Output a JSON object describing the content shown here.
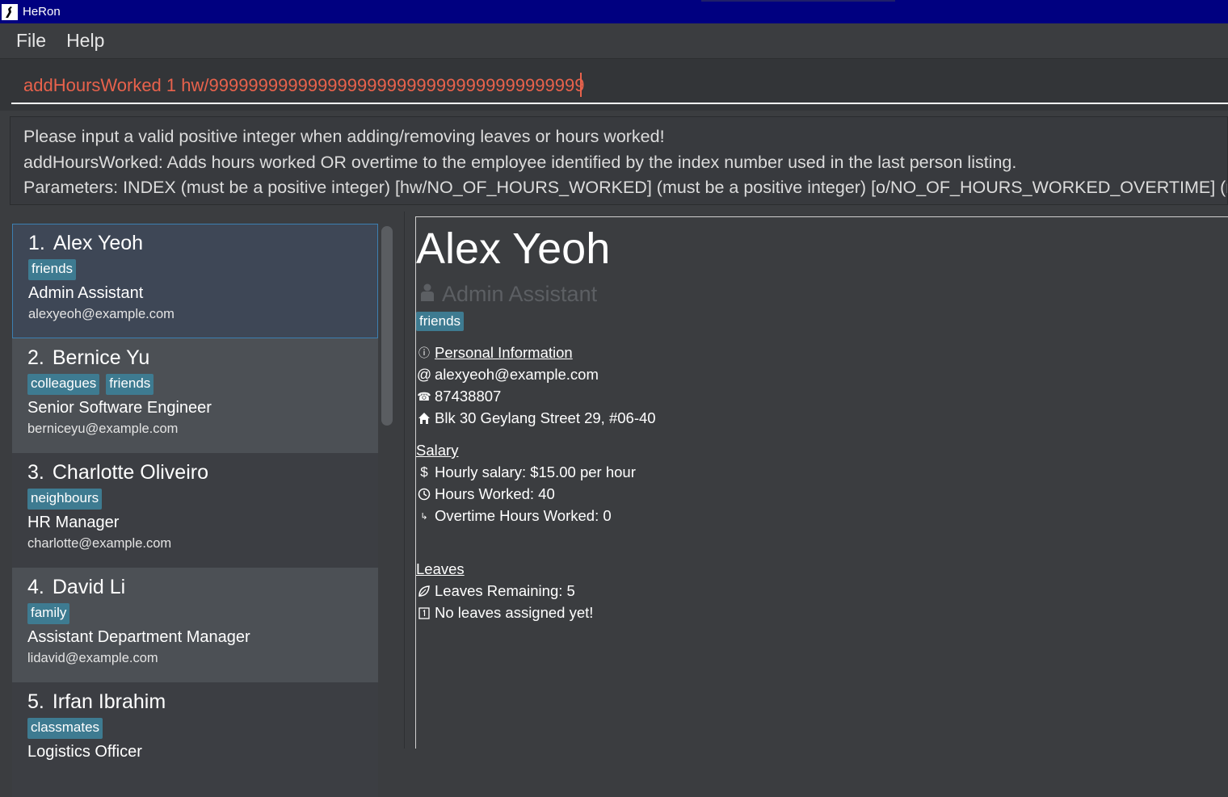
{
  "window": {
    "title": "HeRon"
  },
  "menu": {
    "file": "File",
    "help": "Help"
  },
  "command": {
    "value": "addHoursWorked 1 hw/99999999999999999999999999999999999999"
  },
  "result": {
    "lines": [
      "Please input a valid positive integer when adding/removing leaves or hours worked!",
      "addHoursWorked: Adds hours worked OR overtime to the employee identified by the index number used in the last person listing.",
      "Parameters: INDEX (must be a positive integer) [hw/NO_OF_HOURS_WORKED] (must be a positive integer) [o/NO_OF_HOURS_WORKED_OVERTIME] (must be a positive integer)"
    ]
  },
  "persons": [
    {
      "index": "1.",
      "name": "Alex Yeoh",
      "tags": [
        "friends"
      ],
      "role": "Admin Assistant",
      "email": "alexyeoh@example.com"
    },
    {
      "index": "2.",
      "name": "Bernice Yu",
      "tags": [
        "colleagues",
        "friends"
      ],
      "role": "Senior Software Engineer",
      "email": "berniceyu@example.com"
    },
    {
      "index": "3.",
      "name": "Charlotte Oliveiro",
      "tags": [
        "neighbours"
      ],
      "role": "HR Manager",
      "email": "charlotte@example.com"
    },
    {
      "index": "4.",
      "name": "David Li",
      "tags": [
        "family"
      ],
      "role": "Assistant Department Manager",
      "email": "lidavid@example.com"
    },
    {
      "index": "5.",
      "name": "Irfan Ibrahim",
      "tags": [
        "classmates"
      ],
      "role": "Logistics Officer",
      "email": ""
    }
  ],
  "detail": {
    "name": "Alex Yeoh",
    "role": "Admin Assistant",
    "tags": [
      "friends"
    ],
    "personal_header": "Personal Information",
    "email": "alexyeoh@example.com",
    "phone": "87438807",
    "address": "Blk 30 Geylang Street 29, #06-40",
    "salary_header": "Salary",
    "hourly_salary": "Hourly salary: $15.00 per hour",
    "hours_worked": "Hours Worked: 40",
    "overtime": "Overtime Hours Worked: 0",
    "leaves_header": "Leaves",
    "leaves_remaining": "Leaves Remaining: 5",
    "leaves_assigned": "No leaves assigned yet!"
  },
  "colors": {
    "titlebar": "#000080",
    "command_text": "#e8624c",
    "tag_bg": "#3e7b91",
    "selected_border": "#3c7fb1"
  }
}
